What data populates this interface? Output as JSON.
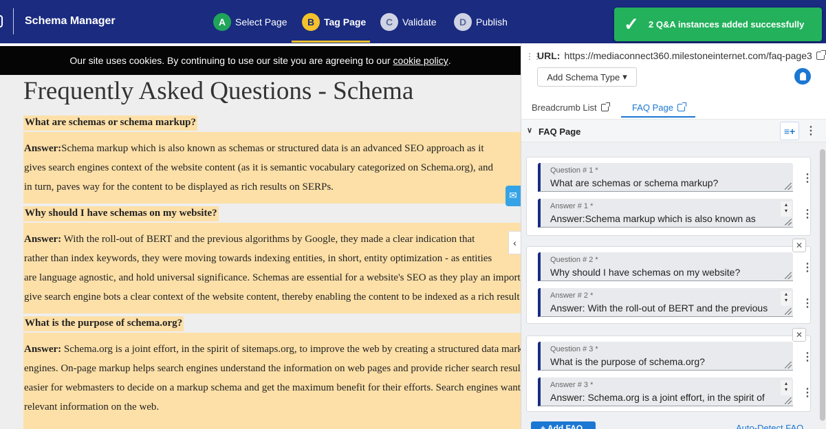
{
  "header": {
    "app_title": "Schema Manager",
    "steps": [
      {
        "letter": "A",
        "label": "Select Page"
      },
      {
        "letter": "B",
        "label": "Tag Page"
      },
      {
        "letter": "C",
        "label": "Validate"
      },
      {
        "letter": "D",
        "label": "Publish"
      }
    ],
    "active_step": "Tag Page",
    "toast": {
      "icon": "check-icon",
      "message": "2 Q&A instances added successfully"
    }
  },
  "preview": {
    "cookie_text": "Our site uses cookies. By continuing to use our site you are agreeing to our",
    "cookie_link": "cookie policy",
    "cookie_end": ".",
    "page_title": "Frequently Asked Questions - Schema",
    "faqs": [
      {
        "question": "What are schemas or schema markup?",
        "answer_lead": "Answer:",
        "answer_lines": [
          "Schema markup which is also known as schemas or structured data is an advanced SEO approach as it",
          "gives search engines context of the website content (as it is semantic vocabulary categorized on Schema.org), and",
          "in turn, paves way for the content to be displayed as rich results on SERPs."
        ]
      },
      {
        "question": "Why should I have schemas on my website?",
        "answer_lead": "Answer:",
        "answer_lines": [
          " With the roll-out of BERT and the previous algorithms by Google, they made a clear indication that",
          "rather than index keywords, they were moving towards indexing entities, in short, entity optimization - as entities",
          "are language agnostic, and hold universal significance. Schemas are essential for a website's SEO as they play an import",
          "give search engine bots a clear context of the website content, thereby enabling the content to be indexed as a rich result"
        ]
      },
      {
        "question": "What is the purpose of schema.org?",
        "answer_lead": "Answer:",
        "answer_lines": [
          " Schema.org is a joint effort, in the spirit of sitemaps.org, to improve the web by creating a structured data mark",
          "engines. On-page markup helps search engines understand the information on web pages and provide richer search resul",
          "easier for webmasters to decide on a markup schema and get the maximum benefit for their efforts. Search engines want",
          "relevant information on the web."
        ]
      }
    ],
    "side_widget_icon": "chat-icon",
    "collapse_icon": "chevron-left-icon"
  },
  "panel": {
    "url_label": "URL:",
    "url": "https://mediaconnect360.milestoneinternet.com/faq-page3",
    "add_schema_label": "Add Schema Type",
    "add_schema_caret": "▾",
    "tabs": [
      {
        "label": "Breadcrumb List"
      },
      {
        "label": "FAQ Page"
      }
    ],
    "active_tab": "FAQ Page",
    "section_title": "FAQ Page",
    "section_chevron": "∨",
    "fields": [
      {
        "question_label": "Question # 1 *",
        "question_value": "What are schemas or schema markup?",
        "answer_label": "Answer # 1 *",
        "answer_value": "Answer:Schema markup which is also known as"
      },
      {
        "question_label": "Question # 2 *",
        "question_value": "Why should I have schemas on my website?",
        "answer_label": "Answer # 2 *",
        "answer_value": "Answer: With the roll-out of BERT and the previous"
      },
      {
        "question_label": "Question # 3 *",
        "question_value": "What is the purpose of schema.org?",
        "answer_label": "Answer # 3 *",
        "answer_value": "Answer: Schema.org is a joint effort, in the spirit of"
      }
    ],
    "add_faq_label": "+ Add FAQ",
    "auto_detect_label": "Auto-Detect FAQ"
  },
  "colors": {
    "header_bg": "#1a2b80",
    "accent": "#f4c22a",
    "success": "#23b15c",
    "link": "#1b77d3",
    "highlight": "#fde0a8"
  }
}
